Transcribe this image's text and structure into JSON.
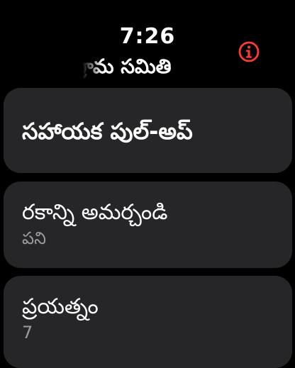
{
  "status": {
    "time": "7:26"
  },
  "header": {
    "title": "గ్రామ సమితి"
  },
  "accent_color": "#ff3b30",
  "info_icon": "info-circle-icon",
  "workout": {
    "title": "సహాయక పుల్-అప్"
  },
  "settings": [
    {
      "label": "రకాన్ని అమర్చండి",
      "value": "పని"
    },
    {
      "label": "ప్రయత్నం",
      "value": "7"
    }
  ]
}
